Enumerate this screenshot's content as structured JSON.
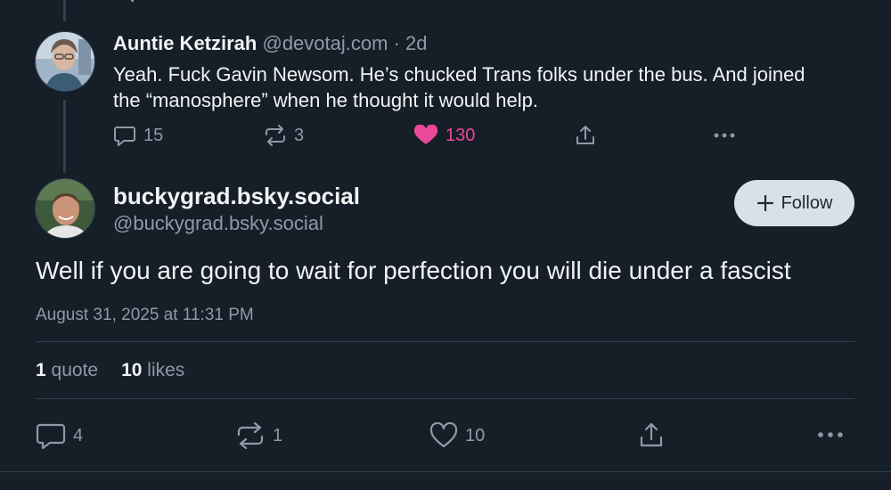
{
  "reply": {
    "display_name": "Auntie Ketzirah",
    "handle": "@devotaj.com",
    "time_ago": "· 2d",
    "text": "Yeah. Fuck Gavin Newsom. He’s chucked Trans folks under the bus. And joined the “manosphere” when he thought it would help.",
    "replies": "15",
    "reposts": "3",
    "likes": "130",
    "liked": true
  },
  "post": {
    "display_name": "buckygrad.bsky.social",
    "handle": "@buckygrad.bsky.social",
    "follow_label": "Follow",
    "text": "Well if you are going to wait for perfection you will die under a fascist",
    "timestamp": "August 31, 2025 at 11:31 PM",
    "stats": {
      "quotes_count": "1",
      "quotes_label": "quote",
      "likes_count": "10",
      "likes_label": "likes"
    },
    "replies": "4",
    "reposts": "1",
    "likes": "10"
  },
  "colors": {
    "background": "#161e27",
    "muted_text": "#8d9aa8",
    "like_pink": "#ec4899",
    "follow_button": "#d9e0e8",
    "divider": "#2e4052"
  },
  "icons": [
    "reply-icon",
    "repost-icon",
    "heart-icon",
    "share-icon",
    "more-icon",
    "plus-icon"
  ]
}
